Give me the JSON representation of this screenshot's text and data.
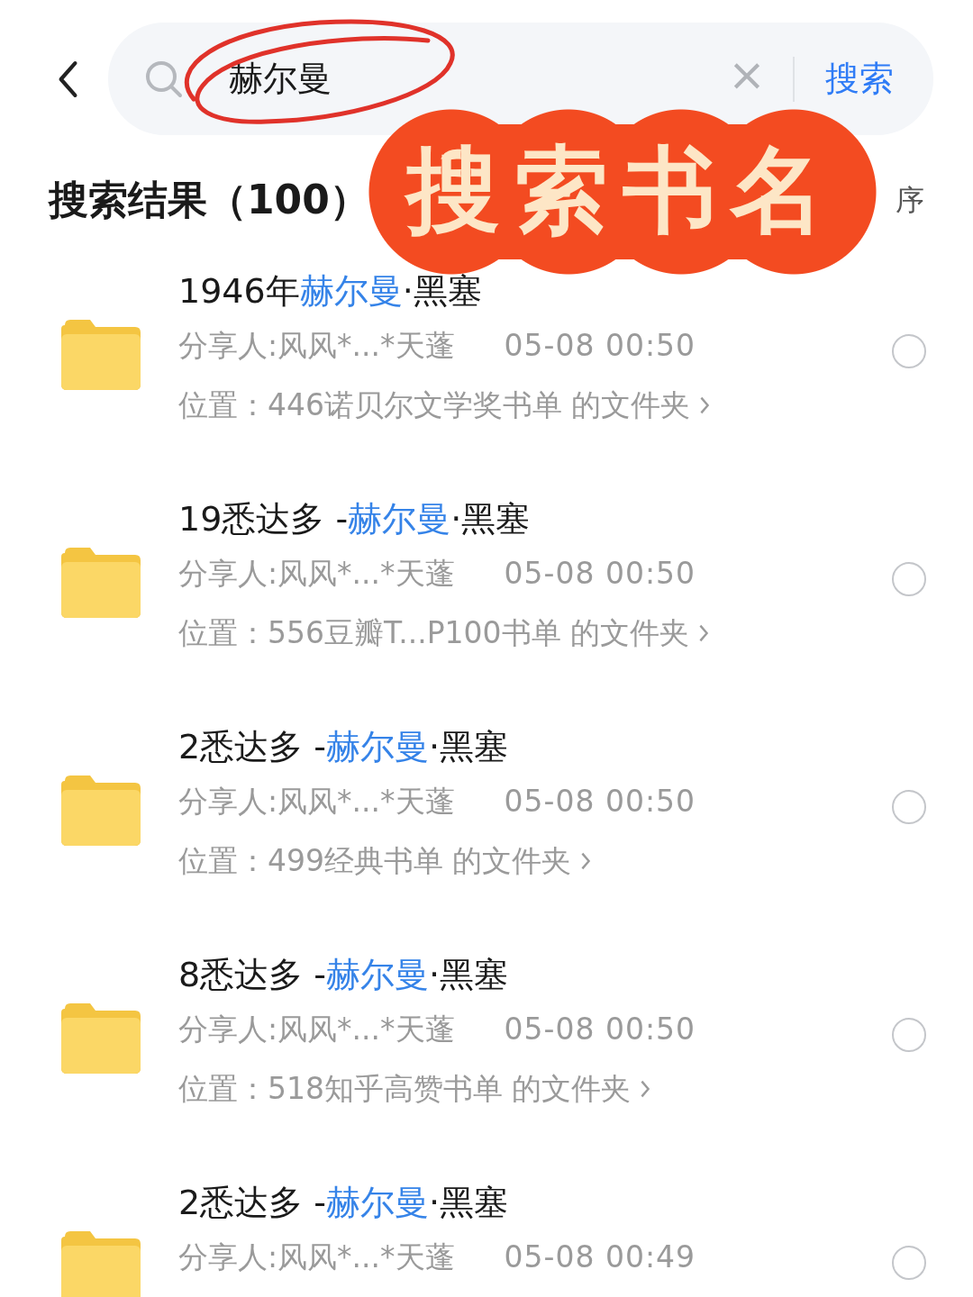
{
  "search": {
    "value": "赫尔曼",
    "clear": "×",
    "button": "搜索"
  },
  "results": {
    "heading": "搜索结果（100）",
    "sort": "序"
  },
  "annotation": {
    "text": "搜索书名"
  },
  "items": [
    {
      "title_before": "1946年",
      "title_match": "赫尔曼",
      "title_after": "·黑塞",
      "sharer": "分享人:风风*...*天蓬",
      "time": "05-08 00:50",
      "location": "位置：446诺贝尔文学奖书单 的文件夹",
      "selected": false
    },
    {
      "title_before": "19悉达多 -",
      "title_match": "赫尔曼",
      "title_after": "·黑塞",
      "sharer": "分享人:风风*...*天蓬",
      "time": "05-08 00:50",
      "location": "位置：556豆瓣T...P100书单 的文件夹",
      "selected": false
    },
    {
      "title_before": "2悉达多 -",
      "title_match": "赫尔曼",
      "title_after": "·黑塞",
      "sharer": "分享人:风风*...*天蓬",
      "time": "05-08 00:50",
      "location": "位置：499经典书单 的文件夹",
      "selected": false
    },
    {
      "title_before": "8悉达多 -",
      "title_match": "赫尔曼",
      "title_after": "·黑塞",
      "sharer": "分享人:风风*...*天蓬",
      "time": "05-08 00:50",
      "location": "位置：518知乎高赞书单 的文件夹",
      "selected": false
    },
    {
      "title_before": "2悉达多 -",
      "title_match": "赫尔曼",
      "title_after": "·黑塞",
      "sharer": "分享人:风风*...*天蓬",
      "time": "05-08 00:49",
      "selected": false
    }
  ]
}
